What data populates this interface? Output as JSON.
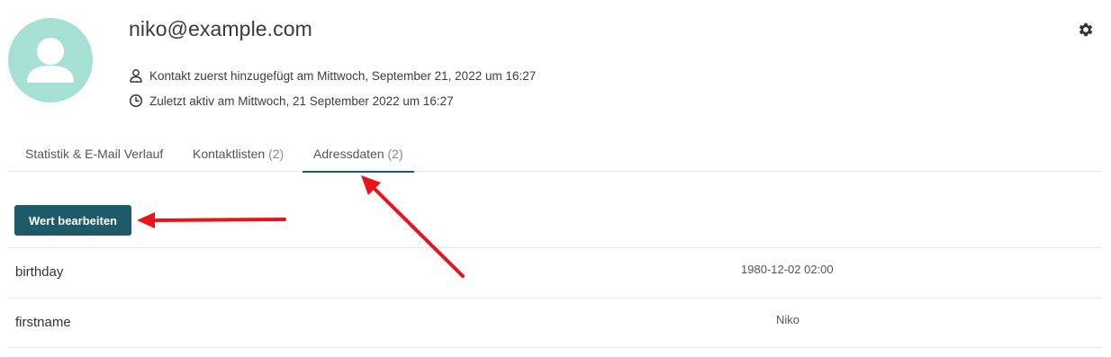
{
  "contact": {
    "email": "niko@example.com",
    "added_text": "Kontakt zuerst hinzugefügt am Mittwoch, September 21, 2022 um 16:27",
    "last_active_text": "Zuletzt aktiv am Mittwoch, 21 September 2022 um 16:27"
  },
  "icons": {
    "avatar": "person-avatar-icon",
    "added": "person-icon",
    "last_active": "clock-icon",
    "settings": "gear-icon"
  },
  "tabs": [
    {
      "label": "Statistik & E-Mail Verlauf",
      "count": ""
    },
    {
      "label": "Kontaktlisten",
      "count": "(2)"
    },
    {
      "label": "Adressdaten",
      "count": "(2)",
      "active": true
    }
  ],
  "actions": {
    "edit_label": "Wert bearbeiten"
  },
  "fields": [
    {
      "key": "birthday",
      "value": "1980-12-02 02:00"
    },
    {
      "key": "firstname",
      "value": "Niko"
    }
  ],
  "colors": {
    "primary": "#1f5a68",
    "avatar_bg": "#a6e0d4",
    "annotation": "#e8141a"
  }
}
